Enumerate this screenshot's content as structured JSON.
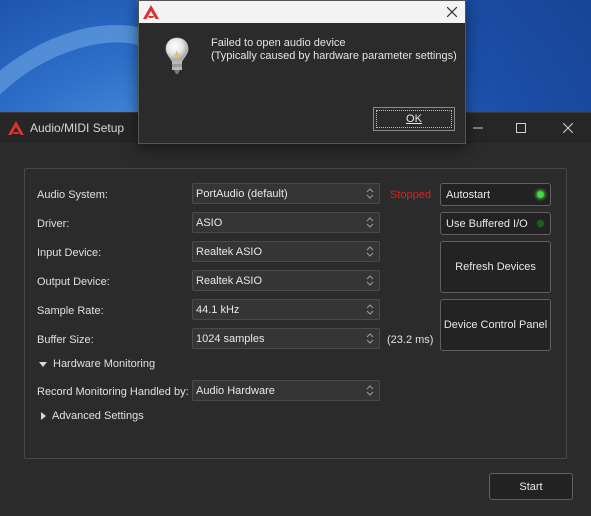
{
  "dialog": {
    "message_line1": "Failed to open audio device",
    "message_line2": "(Typically caused by hardware parameter settings)",
    "ok_label": "OK",
    "icon": "lightbulb-icon"
  },
  "window": {
    "title": "Audio/MIDI Setup",
    "icon": "app-logo-icon"
  },
  "settings": {
    "audio_system": {
      "label": "Audio System:",
      "value": "PortAudio (default)"
    },
    "driver": {
      "label": "Driver:",
      "value": "ASIO"
    },
    "input_device": {
      "label": "Input Device:",
      "value": "Realtek ASIO"
    },
    "output_device": {
      "label": "Output Device:",
      "value": "Realtek ASIO"
    },
    "sample_rate": {
      "label": "Sample Rate:",
      "value": "44.1 kHz"
    },
    "buffer_size": {
      "label": "Buffer Size:",
      "value": "1024 samples",
      "latency": "(23.2 ms)"
    },
    "hardware_monitoring": {
      "label": "Hardware Monitoring",
      "expanded": true
    },
    "record_monitoring": {
      "label": "Record Monitoring Handled by:",
      "value": "Audio Hardware"
    },
    "advanced_settings": {
      "label": "Advanced Settings",
      "expanded": false
    }
  },
  "status": {
    "text": "Stopped",
    "color": "#e0201e"
  },
  "buttons": {
    "autostart": {
      "label": "Autostart",
      "on": true
    },
    "use_buffered_io": {
      "label": "Use Buffered I/O",
      "on": false
    },
    "refresh_devices": "Refresh Devices",
    "device_control_panel": "Device Control Panel",
    "start": "Start"
  },
  "colors": {
    "window_bg": "#2b2b2b",
    "led_on": "#4cd44c",
    "led_off": "#1d5e1d",
    "logo_red": "#d9322f"
  }
}
